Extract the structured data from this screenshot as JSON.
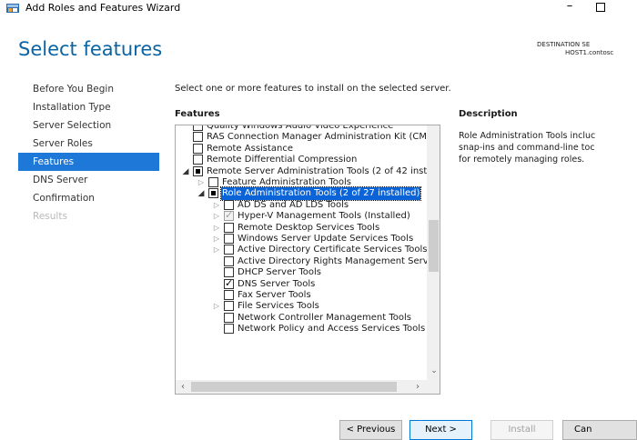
{
  "window": {
    "title": "Add Roles and Features Wizard",
    "min_glyph": "–"
  },
  "page": {
    "title": "Select features",
    "destination_label": "DESTINATION SE",
    "destination_host": "HOST1.contosc"
  },
  "nav": {
    "items": [
      {
        "label": "Before You Begin",
        "state": "normal"
      },
      {
        "label": "Installation Type",
        "state": "normal"
      },
      {
        "label": "Server Selection",
        "state": "normal"
      },
      {
        "label": "Server Roles",
        "state": "normal"
      },
      {
        "label": "Features",
        "state": "active"
      },
      {
        "label": "DNS Server",
        "state": "normal"
      },
      {
        "label": "Confirmation",
        "state": "normal"
      },
      {
        "label": "Results",
        "state": "disabled"
      }
    ]
  },
  "content": {
    "instruction": "Select one or more features to install on the selected server.",
    "features_heading": "Features",
    "description_heading": "Description",
    "description_lines": [
      "Role Administration Tools incluc",
      "snap-ins and command-line toc",
      "for remotely managing roles."
    ]
  },
  "tree": {
    "rows": [
      {
        "label": "Quality Windows Audio Video Experience",
        "level": 0,
        "expander": "none",
        "check": "unchecked"
      },
      {
        "label": "RAS Connection Manager Administration Kit (CMA",
        "level": 0,
        "expander": "none",
        "check": "unchecked"
      },
      {
        "label": "Remote Assistance",
        "level": 0,
        "expander": "none",
        "check": "unchecked"
      },
      {
        "label": "Remote Differential Compression",
        "level": 0,
        "expander": "none",
        "check": "unchecked"
      },
      {
        "label": "Remote Server Administration Tools (2 of 42 instal",
        "level": 0,
        "expander": "open",
        "check": "partial"
      },
      {
        "label": "Feature Administration Tools",
        "level": 1,
        "expander": "closed",
        "check": "unchecked"
      },
      {
        "label": "Role Administration Tools (2 of 27 installed)",
        "level": 1,
        "expander": "open",
        "check": "partial",
        "selected": true
      },
      {
        "label": "AD DS and AD LDS Tools",
        "level": 2,
        "expander": "closed",
        "check": "unchecked"
      },
      {
        "label": "Hyper-V Management Tools (Installed)",
        "level": 2,
        "expander": "closed",
        "check": "checked-disabled"
      },
      {
        "label": "Remote Desktop Services Tools",
        "level": 2,
        "expander": "closed",
        "check": "unchecked"
      },
      {
        "label": "Windows Server Update Services Tools",
        "level": 2,
        "expander": "closed",
        "check": "unchecked"
      },
      {
        "label": "Active Directory Certificate Services Tools",
        "level": 2,
        "expander": "closed",
        "check": "unchecked"
      },
      {
        "label": "Active Directory Rights Management Servic",
        "level": 2,
        "expander": "none",
        "check": "unchecked"
      },
      {
        "label": "DHCP Server Tools",
        "level": 2,
        "expander": "none",
        "check": "unchecked"
      },
      {
        "label": "DNS Server Tools",
        "level": 2,
        "expander": "none",
        "check": "checked"
      },
      {
        "label": "Fax Server Tools",
        "level": 2,
        "expander": "none",
        "check": "unchecked"
      },
      {
        "label": "File Services Tools",
        "level": 2,
        "expander": "closed",
        "check": "unchecked"
      },
      {
        "label": "Network Controller Management Tools",
        "level": 2,
        "expander": "none",
        "check": "unchecked"
      },
      {
        "label": "Network Policy and Access Services Tools",
        "level": 2,
        "expander": "none",
        "check": "unchecked"
      }
    ]
  },
  "footer": {
    "previous_label": "< Previous",
    "next_label": "Next >",
    "install_label": "Install",
    "cancel_label": "Can"
  },
  "colors": {
    "title_blue": "#0a64a4",
    "nav_active": "#1e78d7",
    "selection": "#0a64d8"
  }
}
